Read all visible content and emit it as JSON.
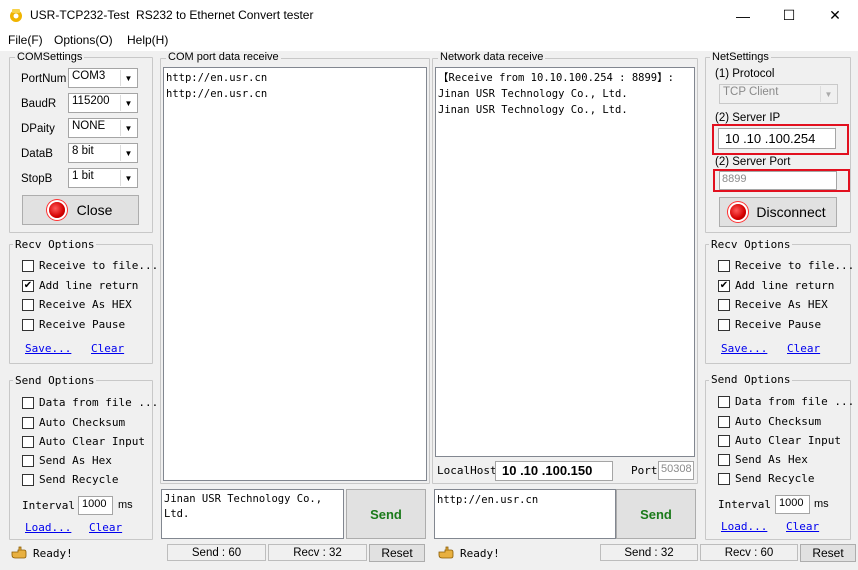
{
  "window": {
    "title": "USR-TCP232-Test  RS232 to Ethernet Convert tester",
    "minimize": "—",
    "maximize": "☐",
    "close": "✕"
  },
  "menu": [
    "File(F)",
    "Options(O)",
    "Help(H)"
  ],
  "com_settings": {
    "title": "COMSettings",
    "fields": [
      {
        "label": "PortNum",
        "value": "COM3"
      },
      {
        "label": "BaudR",
        "value": "115200"
      },
      {
        "label": "DPaity",
        "value": "NONE"
      },
      {
        "label": "DataB",
        "value": "8 bit"
      },
      {
        "label": "StopB",
        "value": "1 bit"
      }
    ],
    "close_button": "Close"
  },
  "left_recv": {
    "title": "Recv Options",
    "options": [
      {
        "label": "Receive to file...",
        "checked": false
      },
      {
        "label": "Add line return",
        "checked": true
      },
      {
        "label": "Receive As HEX",
        "checked": false
      },
      {
        "label": "Receive Pause",
        "checked": false
      }
    ],
    "save": "Save...",
    "clear": "Clear"
  },
  "left_send": {
    "title": "Send Options",
    "options": [
      {
        "label": "Data from file ...",
        "checked": false
      },
      {
        "label": "Auto Checksum",
        "checked": false
      },
      {
        "label": "Auto Clear Input",
        "checked": false
      },
      {
        "label": "Send As Hex",
        "checked": false
      },
      {
        "label": "Send Recycle",
        "checked": false
      }
    ],
    "interval_label": "Interval",
    "interval_value": "1000",
    "interval_unit": "ms",
    "load": "Load...",
    "clear": "Clear"
  },
  "com_receive": {
    "title": "COM port data receive",
    "text": "http://en.usr.cn\nhttp://en.usr.cn"
  },
  "net_receive": {
    "title": "Network data receive",
    "text": "【Receive from 10.10.100.254 : 8899】:\nJinan USR Technology Co., Ltd.\nJinan USR Technology Co., Ltd."
  },
  "localhost": {
    "label": "LocalHost",
    "ip": "10 .10 .100.150",
    "port_label": "Port",
    "port_value": "50308"
  },
  "com_send": {
    "text": "Jinan USR Technology Co.,\nLtd.",
    "button": "Send"
  },
  "net_send": {
    "text": "http://en.usr.cn",
    "button": "Send"
  },
  "net_settings": {
    "title": "NetSettings",
    "protocol_label": "(1) Protocol",
    "protocol_value": "TCP Client",
    "server_ip_label": "(2) Server IP",
    "server_ip_value": "10 .10 .100.254",
    "server_port_label": "(2) Server Port",
    "server_port_value": "8899",
    "disconnect_button": "Disconnect"
  },
  "right_recv": {
    "title": "Recv Options",
    "options": [
      {
        "label": "Receive to file...",
        "checked": false
      },
      {
        "label": "Add line return",
        "checked": true
      },
      {
        "label": "Receive As HEX",
        "checked": false
      },
      {
        "label": "Receive Pause",
        "checked": false
      }
    ],
    "save": "Save...",
    "clear": "Clear"
  },
  "right_send": {
    "title": "Send Options",
    "options": [
      {
        "label": "Data from file ...",
        "checked": false
      },
      {
        "label": "Auto Checksum",
        "checked": false
      },
      {
        "label": "Auto Clear Input",
        "checked": false
      },
      {
        "label": "Send As Hex",
        "checked": false
      },
      {
        "label": "Send Recycle",
        "checked": false
      }
    ],
    "interval_label": "Interval",
    "interval_value": "1000",
    "interval_unit": "ms",
    "load": "Load...",
    "clear": "Clear"
  },
  "status_left": {
    "ready": "Ready!",
    "send": "Send : 60",
    "recv": "Recv : 32",
    "reset": "Reset"
  },
  "status_right": {
    "ready": "Ready!",
    "send": "Send : 32",
    "recv": "Recv : 60",
    "reset": "Reset"
  },
  "colors": {
    "highlight_box": "#e2101f",
    "send_button_text": "#1a7a1a",
    "link": "#0000ee"
  }
}
